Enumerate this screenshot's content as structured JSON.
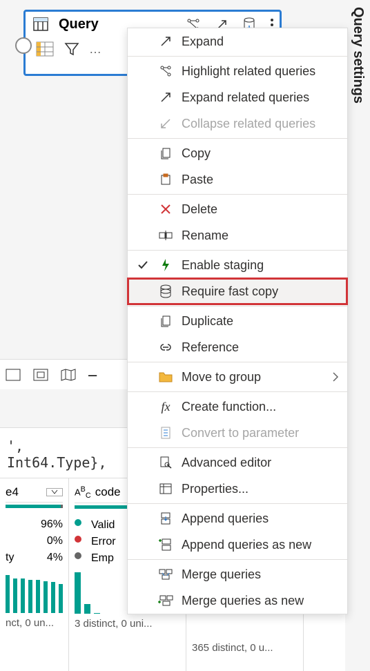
{
  "query_box": {
    "title": "Query"
  },
  "sidebar": {
    "title": "Query settings"
  },
  "menu": {
    "expand": "Expand",
    "highlight_related": "Highlight related queries",
    "expand_related": "Expand related queries",
    "collapse_related": "Collapse related queries",
    "copy": "Copy",
    "paste": "Paste",
    "delete": "Delete",
    "rename": "Rename",
    "enable_staging": "Enable staging",
    "require_fast_copy": "Require fast copy",
    "duplicate": "Duplicate",
    "reference": "Reference",
    "move_to_group": "Move to group",
    "create_function": "Create function...",
    "convert_to_parameter": "Convert to parameter",
    "advanced_editor": "Advanced editor",
    "properties": "Properties...",
    "append_queries": "Append queries",
    "append_queries_new": "Append queries as new",
    "merge_queries": "Merge queries",
    "merge_queries_new": "Merge queries as new"
  },
  "formula": "', Int64.Type},",
  "columns": [
    {
      "name": "e4",
      "type": "ABC",
      "stats": [
        {
          "label": "",
          "value": "96%",
          "color": "#009e8f"
        },
        {
          "label": "",
          "value": "0%",
          "color": "#d13438"
        },
        {
          "label": "ty",
          "value": "4%",
          "color": "#666"
        }
      ],
      "footer": "nct, 0 un...",
      "bars": [
        55,
        50,
        50,
        48,
        48,
        46,
        45,
        42,
        40
      ]
    },
    {
      "name": "code",
      "type": "ABC",
      "stats": [
        {
          "label": "Valid",
          "value": "",
          "color": "#009e8f"
        },
        {
          "label": "Error",
          "value": "",
          "color": "#d13438"
        },
        {
          "label": "Emp",
          "value": "",
          "color": "#666"
        }
      ],
      "footer": "3 distinct, 0 uni...",
      "bars": [
        60,
        14,
        0,
        0,
        0,
        0,
        0,
        0,
        0
      ]
    },
    {
      "name": "",
      "footer": "365 distinct, 0 u..."
    }
  ]
}
